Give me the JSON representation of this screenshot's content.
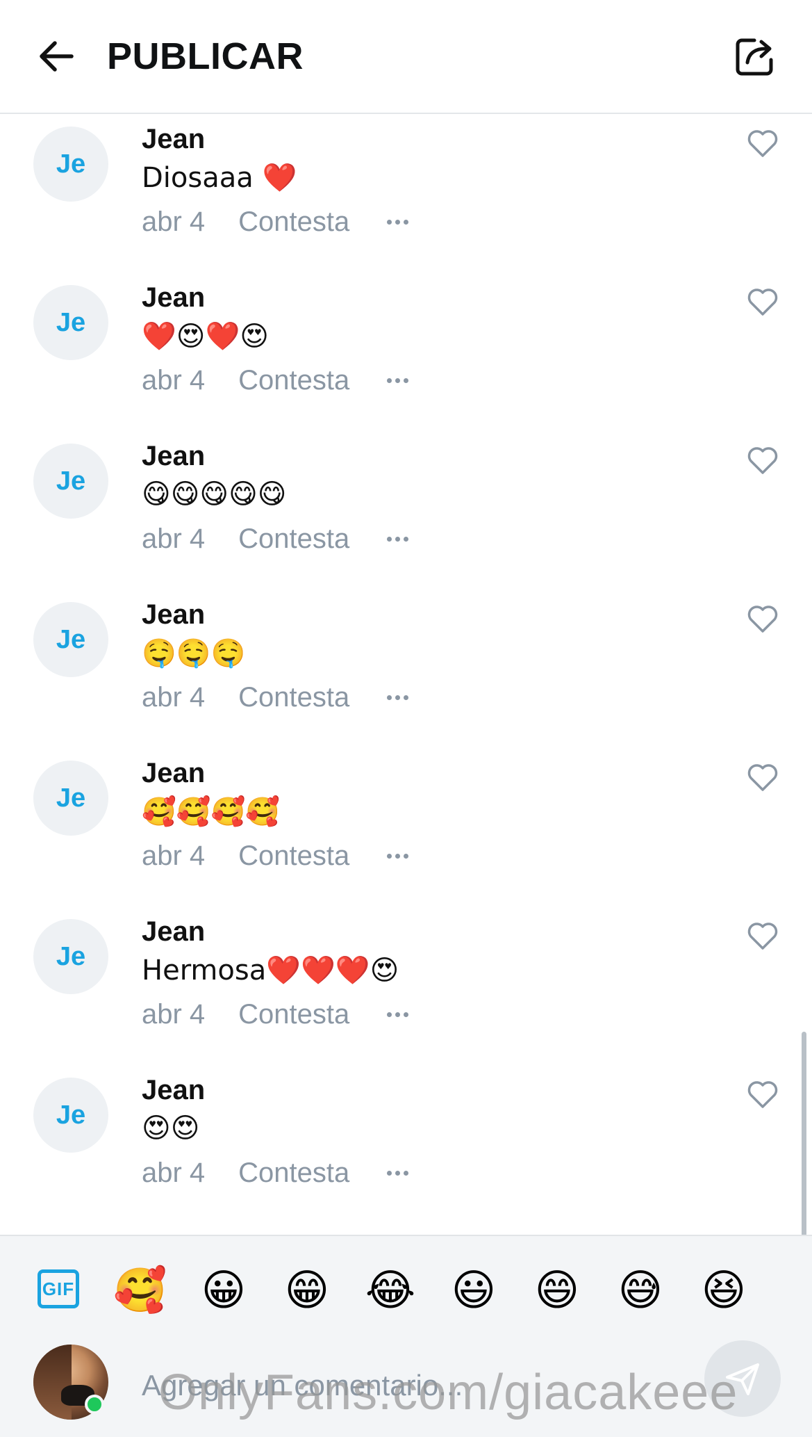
{
  "header": {
    "title": "PUBLICAR",
    "back_icon": "arrow-left-icon",
    "share_icon": "share-icon"
  },
  "comments": [
    {
      "initials": "Je",
      "name": "Jean",
      "text": "Diosaaa ❤️",
      "date": "abr 4",
      "reply_label": "Contesta"
    },
    {
      "initials": "Je",
      "name": "Jean",
      "text": "❤️😍❤️😍",
      "date": "abr 4",
      "reply_label": "Contesta"
    },
    {
      "initials": "Je",
      "name": "Jean",
      "text": "😋😋😋😋😋",
      "date": "abr 4",
      "reply_label": "Contesta"
    },
    {
      "initials": "Je",
      "name": "Jean",
      "text": "🤤🤤🤤",
      "date": "abr 4",
      "reply_label": "Contesta"
    },
    {
      "initials": "Je",
      "name": "Jean",
      "text": "🥰🥰🥰🥰",
      "date": "abr 4",
      "reply_label": "Contesta"
    },
    {
      "initials": "Je",
      "name": "Jean",
      "text": "Hermosa❤️❤️❤️😍",
      "date": "abr 4",
      "reply_label": "Contesta"
    },
    {
      "initials": "Je",
      "name": "Jean",
      "text": "😍😍",
      "date": "abr 4",
      "reply_label": "Contesta"
    }
  ],
  "emoji_bar": {
    "gif_label": "GIF",
    "emojis": [
      "🥰",
      "😀",
      "😁",
      "😂",
      "😃",
      "😄",
      "😅",
      "😆"
    ]
  },
  "composer": {
    "placeholder": "Agregar un comentario...",
    "send_icon": "send-icon"
  },
  "watermark": "OnlyFans.com/giacakeee",
  "colors": {
    "accent": "#1aa3e0",
    "muted_text": "#8a96a3",
    "online": "#1ec85b"
  }
}
